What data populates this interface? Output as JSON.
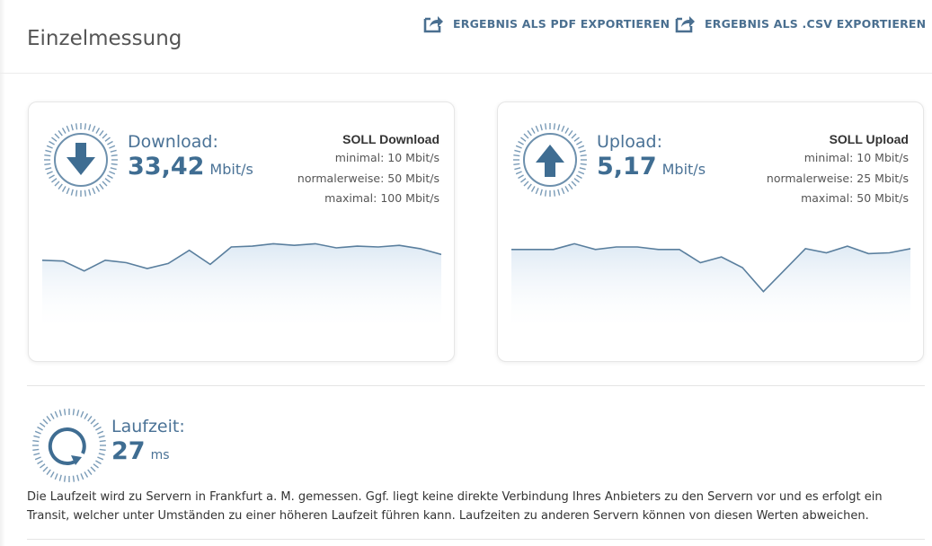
{
  "page": {
    "title": "Einzelmessung"
  },
  "toolbar": {
    "export_pdf_label": "ERGEBNIS ALS PDF EXPORTIEREN",
    "export_csv_label": "ERGEBNIS ALS .CSV EXPORTIEREN"
  },
  "download": {
    "label": "Download:",
    "value": "33,42",
    "unit": "Mbit/s",
    "soll_title": "SOLL Download",
    "soll_min": "minimal: 10 Mbit/s",
    "soll_normal": "normalerweise: 50 Mbit/s",
    "soll_max": "maximal: 100 Mbit/s",
    "icon": "arrow-down-icon",
    "series": [
      0.72,
      0.71,
      0.59,
      0.72,
      0.69,
      0.62,
      0.68,
      0.84,
      0.67,
      0.88,
      0.89,
      0.92,
      0.9,
      0.92,
      0.87,
      0.89,
      0.88,
      0.9,
      0.86,
      0.79
    ]
  },
  "upload": {
    "label": "Upload:",
    "value": "5,17",
    "unit": "Mbit/s",
    "soll_title": "SOLL Upload",
    "soll_min": "minimal: 10 Mbit/s",
    "soll_normal": "normalerweise: 25 Mbit/s",
    "soll_max": "maximal: 50 Mbit/s",
    "icon": "arrow-up-icon",
    "series": [
      0.85,
      0.85,
      0.85,
      0.92,
      0.85,
      0.88,
      0.88,
      0.85,
      0.85,
      0.69,
      0.76,
      0.63,
      0.34,
      0.6,
      0.86,
      0.81,
      0.89,
      0.8,
      0.81,
      0.86
    ]
  },
  "latency": {
    "label": "Laufzeit:",
    "value": "27",
    "unit": "ms",
    "icon": "refresh-icon",
    "description": "Die Laufzeit wird zu Servern in Frankfurt a. M. gemessen. Ggf. liegt keine direkte Verbindung Ihres Anbieters zu den Servern vor und es erfolgt ein Transit, welcher unter Umständen zu einer höheren Laufzeit führen kann. Laufzeiten zu anderen Servern können von diesen Werten abweichen."
  },
  "colors": {
    "accent": "#3f6d92",
    "line": "#5a7f9e",
    "fill_top": "#dde9f4",
    "dial_ticks": "#7a9bb7"
  }
}
